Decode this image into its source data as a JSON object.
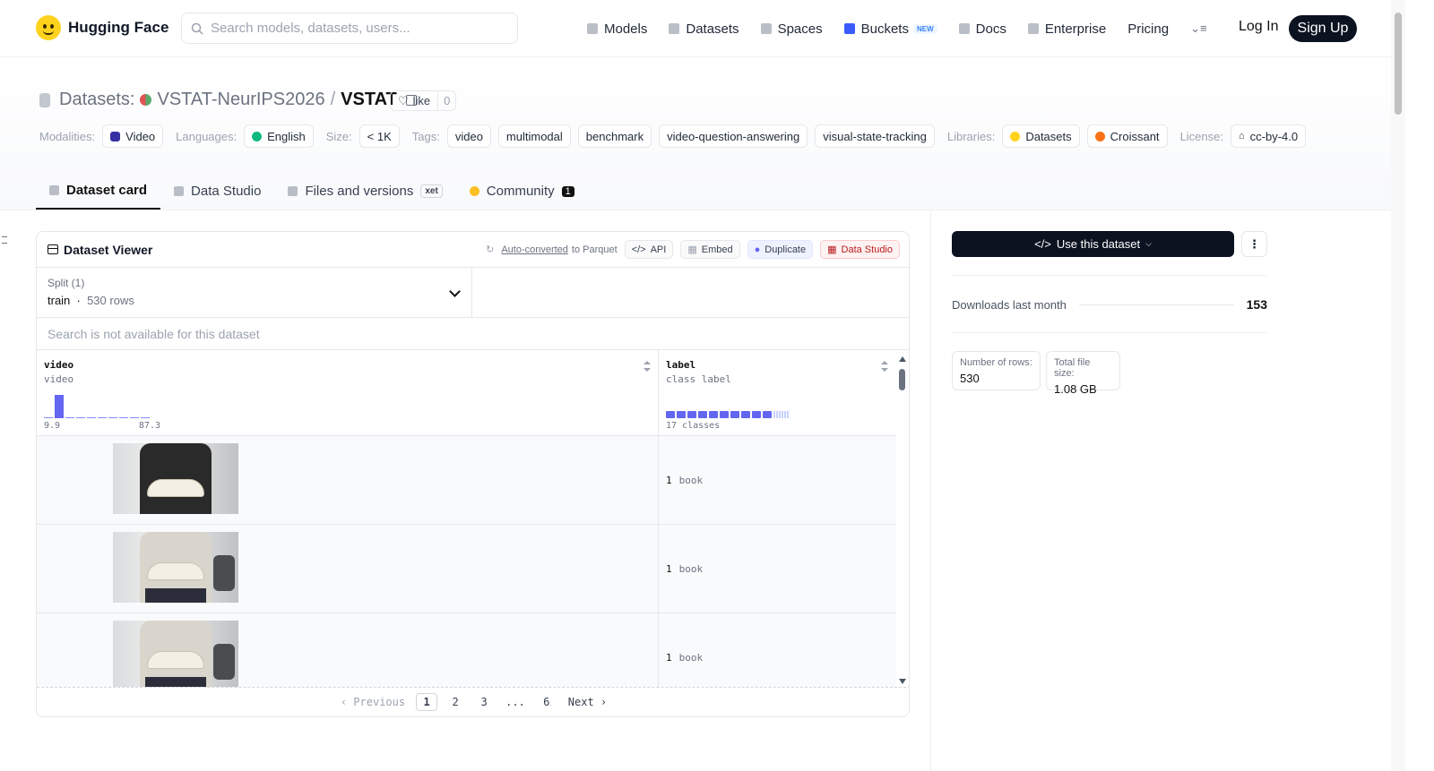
{
  "nav": {
    "brand": "Hugging Face",
    "search_placeholder": "Search models, datasets, users...",
    "links": [
      "Models",
      "Datasets",
      "Spaces",
      "Buckets",
      "Docs",
      "Enterprise",
      "Pricing"
    ],
    "new_badge": "NEW",
    "login": "Log In",
    "signup": "Sign Up"
  },
  "header": {
    "section": "Datasets:",
    "org": "VSTAT-NeurIPS2026",
    "sep": "/",
    "name": "VSTAT",
    "like_label": "like",
    "like_count": "0"
  },
  "meta": {
    "modalities_label": "Modalities:",
    "modality": "Video",
    "languages_label": "Languages:",
    "language": "English",
    "size_label": "Size:",
    "size": "< 1K",
    "tags_label": "Tags:",
    "tags": [
      "video",
      "multimodal",
      "benchmark",
      "video-question-answering",
      "visual-state-tracking"
    ],
    "libraries_label": "Libraries:",
    "libraries": [
      "Datasets",
      "Croissant"
    ],
    "license_label": "License:",
    "license": "cc-by-4.0"
  },
  "tabs": {
    "card": "Dataset card",
    "studio": "Data Studio",
    "files": "Files and versions",
    "xet": "xet",
    "community": "Community",
    "community_count": "1"
  },
  "viewer": {
    "title": "Dataset Viewer",
    "auto": "Auto-converted",
    "auto_suffix": "to Parquet",
    "api": "API",
    "embed": "Embed",
    "duplicate": "Duplicate",
    "data_studio": "Data Studio",
    "split_label": "Split (1)",
    "split_name": "train",
    "split_rows": "530 rows",
    "search_note": "Search is not available for this dataset",
    "col1_name": "video",
    "col1_type": "video",
    "col1_min": "9.9",
    "col1_max": "87.3",
    "col1_hist": [
      0.04,
      1.0,
      0.04,
      0.04,
      0.04,
      0.04,
      0.04,
      0.04,
      0.04,
      0.04
    ],
    "col2_name": "label",
    "col2_type": "class label",
    "col2_classes": "17 classes",
    "rows": [
      {
        "label_value": "1",
        "label_name": "book"
      },
      {
        "label_value": "1",
        "label_name": "book"
      },
      {
        "label_value": "1",
        "label_name": "book"
      }
    ],
    "pager": {
      "prev": "Previous",
      "pages": [
        "1",
        "2",
        "3",
        "...",
        "6"
      ],
      "next": "Next"
    }
  },
  "sidebar": {
    "use_button": "Use this dataset",
    "downloads_label": "Downloads last month",
    "downloads": "153",
    "rows_label": "Number of rows:",
    "rows_value": "530",
    "size_label": "Total file size:",
    "size_value": "1.08 GB"
  }
}
